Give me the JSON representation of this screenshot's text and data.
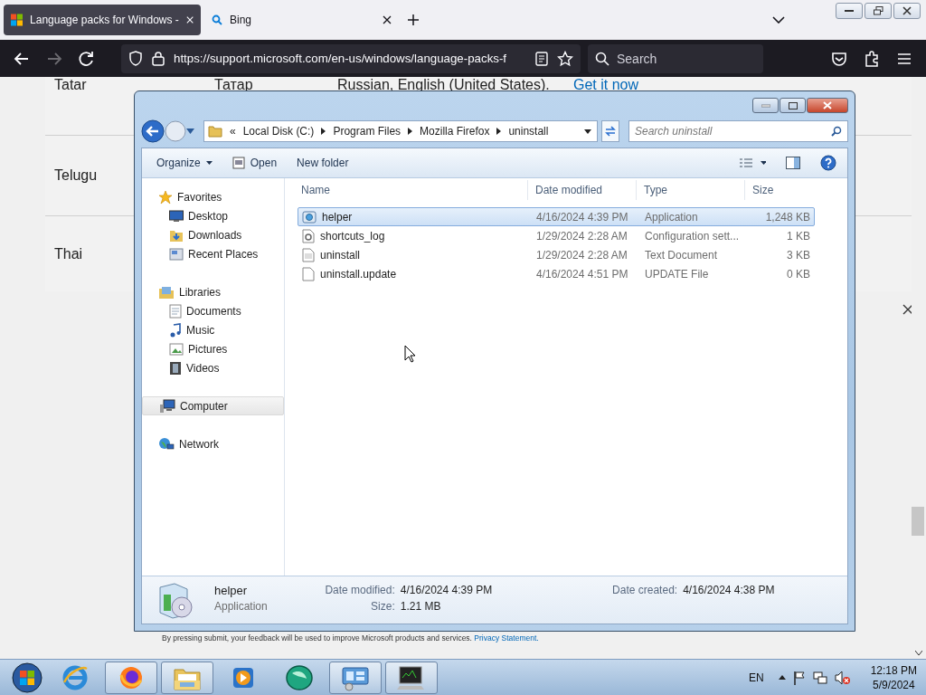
{
  "browser": {
    "tabs": [
      {
        "title": "Language packs for Windows -",
        "selected": true,
        "kind": "windows"
      },
      {
        "title": "Bing",
        "selected": false,
        "kind": "search"
      }
    ],
    "url": "https://support.microsoft.com/en-us/windows/language-packs-f",
    "search_placeholder": "Search"
  },
  "page": {
    "rows": [
      {
        "cells": [
          "Tatar",
          "Татар",
          "Russian, English (United States).",
          "Get it now"
        ]
      },
      {
        "cells": [
          "Telugu"
        ]
      },
      {
        "cells": [
          "Thai"
        ]
      }
    ],
    "footer": "By pressing submit, your feedback will be used to improve Microsoft products and services.",
    "footer_link": "Privacy Statement."
  },
  "explorer": {
    "breadcrumb_overflow": "«",
    "breadcrumb": [
      "Local Disk (C:)",
      "Program Files",
      "Mozilla Firefox",
      "uninstall"
    ],
    "search_placeholder": "Search uninstall",
    "toolbar": [
      {
        "label": "Organize",
        "kind": "menu"
      },
      {
        "label": "Open",
        "kind": "open"
      },
      {
        "label": "New folder",
        "kind": "plain"
      }
    ],
    "nav": [
      {
        "label": "Favorites",
        "kind": "star",
        "selected": false,
        "children": [
          {
            "label": "Desktop",
            "kind": "desktop",
            "selected": false
          },
          {
            "label": "Downloads",
            "kind": "downloads",
            "selected": false
          },
          {
            "label": "Recent Places",
            "kind": "recent",
            "selected": false
          }
        ]
      },
      {
        "label": "Libraries",
        "kind": "library",
        "selected": false,
        "children": [
          {
            "label": "Documents",
            "kind": "documents",
            "selected": false
          },
          {
            "label": "Music",
            "kind": "music",
            "selected": false
          },
          {
            "label": "Pictures",
            "kind": "pictures",
            "selected": false
          },
          {
            "label": "Videos",
            "kind": "videos",
            "selected": false
          }
        ]
      },
      {
        "label": "Computer",
        "kind": "computer",
        "selected": true
      },
      {
        "label": "Network",
        "kind": "network",
        "selected": false
      }
    ],
    "columns": [
      "Name",
      "Date modified",
      "Type",
      "Size"
    ],
    "files": [
      {
        "name": "helper",
        "date": "4/16/2024 4:39 PM",
        "type": "Application",
        "size": "1,248 KB",
        "kind": "app",
        "selected": true
      },
      {
        "name": "shortcuts_log",
        "date": "1/29/2024 2:28 AM",
        "type": "Configuration sett...",
        "size": "1 KB",
        "kind": "config",
        "selected": false
      },
      {
        "name": "uninstall",
        "date": "1/29/2024 2:28 AM",
        "type": "Text Document",
        "size": "3 KB",
        "kind": "text",
        "selected": false
      },
      {
        "name": "uninstall.update",
        "date": "4/16/2024 4:51 PM",
        "type": "UPDATE File",
        "size": "0 KB",
        "kind": "blank",
        "selected": false
      }
    ],
    "details": {
      "name": "helper",
      "type": "Application",
      "fields": [
        {
          "label": "Date modified:",
          "value": "4/16/2024 4:39 PM"
        },
        {
          "label": "Size:",
          "value": "1.21 MB"
        },
        {
          "label": "Date created:",
          "value": "4/16/2024 4:38 PM"
        }
      ]
    }
  },
  "taskbar": {
    "apps": [
      {
        "kind": "ie",
        "active": false
      },
      {
        "kind": "firefox",
        "active": true
      },
      {
        "kind": "explorer",
        "active": true
      },
      {
        "kind": "media",
        "active": false
      },
      {
        "kind": "globe",
        "active": false
      },
      {
        "kind": "control",
        "active": true
      },
      {
        "kind": "monitor",
        "active": true
      }
    ],
    "language": "EN",
    "time": "12:18 PM",
    "date": "5/9/2024"
  }
}
